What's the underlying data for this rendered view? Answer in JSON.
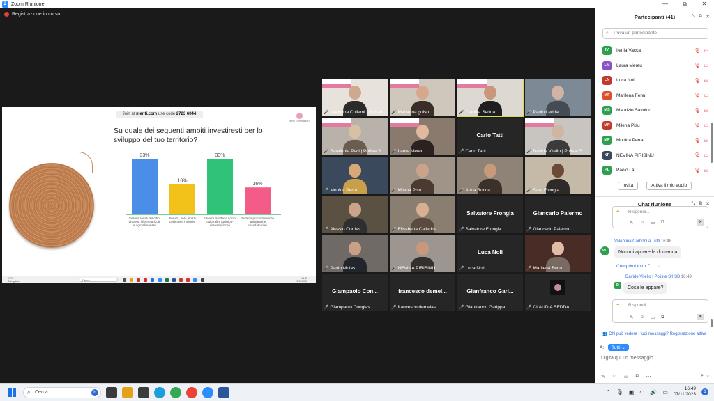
{
  "window": {
    "title": "Zoom Riunione",
    "minimize": "—",
    "maximize": "⧉",
    "close": "✕"
  },
  "recording": {
    "text": "Registrazione in corso"
  },
  "slide": {
    "join_prefix": "Join at",
    "join_site": "menti.com",
    "join_mid": "use code",
    "join_code": "2723 6044",
    "question": "Su quale dei seguenti ambiti investiresti per lo sviluppo del tuo territorio?",
    "logo_text": "Next Generation",
    "inner_taskbar": {
      "weather_temp": "19°C",
      "weather_desc": "Soleggiato",
      "search": "Cerca",
      "time": "16:49",
      "date": "07/11/2023"
    }
  },
  "chart_data": {
    "type": "bar",
    "categories": [
      "Sistemi locali del cibo, distretti, filiere agricole e agroalimentari",
      "Servizi, beni, spazi collettivi e inclusivi",
      "Sistemi di offerta socio-culturali e turistico-ricreativi locali",
      "Sistemi produttivi locali artigianali e manifatturieri"
    ],
    "values": [
      33,
      18,
      33,
      16
    ],
    "value_labels": [
      "33%",
      "18%",
      "33%",
      "16%"
    ],
    "colors": [
      "#4a8ee8",
      "#f2c21b",
      "#2fc37a",
      "#f25c86"
    ],
    "ylim": [
      0,
      40
    ]
  },
  "tiles": [
    {
      "name": "Valentina Chilemi | Poliste ...",
      "video": true,
      "slide": true,
      "bg": "#e8e2dc",
      "head": "#cfa890",
      "torso": "#2b2b2b",
      "active": false
    },
    {
      "name": "Marianna guiso",
      "video": true,
      "slide": true,
      "bg": "#cfc6bc",
      "head": "#d6a98c",
      "torso": "#3a2e28",
      "active": false
    },
    {
      "name": "Claudia Sedda",
      "video": true,
      "slide": true,
      "bg": "#ddd8d2",
      "head": "#c9977c",
      "torso": "#1f1f1f",
      "active": true
    },
    {
      "name": "Paolo Ledda",
      "video": true,
      "slide": false,
      "bg": "#7d8a95",
      "head": "#d2b3a3",
      "torso": "#444b55",
      "active": false
    },
    {
      "name": "Sarafenia Paci | Poliste S...",
      "video": true,
      "slide": true,
      "bg": "#b9b2aa",
      "head": "#d8c0a4",
      "torso": "#6b5c50",
      "active": false
    },
    {
      "name": "Laura Mereu",
      "video": true,
      "slide": true,
      "bg": "#8a7a6e",
      "head": "#e0b9a0",
      "torso": "#2a2220",
      "active": false
    },
    {
      "name": "Carlo Tatti",
      "video": false,
      "display": "Carlo Tatti",
      "active": false
    },
    {
      "name": "Davide Vitello | Poliste S...",
      "video": true,
      "slide": true,
      "bg": "#c8c4bf",
      "head": "#d0b5a2",
      "torso": "#3b3b3b",
      "active": false
    },
    {
      "name": "Monica Perra",
      "video": true,
      "slide": false,
      "bg": "#3a4a5c",
      "head": "#d9a877",
      "torso": "#c9a04a",
      "active": false
    },
    {
      "name": "Milena Pisu",
      "video": true,
      "slide": false,
      "bg": "#a09488",
      "head": "#cba28a",
      "torso": "#4a3a32",
      "active": false
    },
    {
      "name": "Anna Rocca",
      "video": true,
      "slide": false,
      "bg": "#8e8376",
      "head": "#c99a7a",
      "torso": "#3b3129",
      "active": false
    },
    {
      "name": "Sara Frongia",
      "video": true,
      "slide": false,
      "bg": "#c5b9a8",
      "head": "#6b4a36",
      "torso": "#2e2a28",
      "active": false
    },
    {
      "name": "Alessio Corrias",
      "video": true,
      "slide": false,
      "bg": "#5b5142",
      "head": "#c9a48a",
      "torso": "#2f2f2f",
      "active": false
    },
    {
      "name": "Elisabetta Calledda",
      "video": true,
      "slide": false,
      "bg": "#8a7e70",
      "head": "#d8b08f",
      "torso": "#5a4b3f",
      "active": false
    },
    {
      "name": "Salvatore Frongia",
      "video": false,
      "display": "Salvatore Frongia",
      "active": false
    },
    {
      "name": "Giancarlo Palermo",
      "video": false,
      "display": "Giancarlo Palermo",
      "active": false
    },
    {
      "name": "Paolo Mulas",
      "video": true,
      "slide": false,
      "bg": "#6f6a66",
      "head": "#c99f85",
      "torso": "#22252b",
      "active": false
    },
    {
      "name": "NEVINA PIRISINU",
      "video": true,
      "slide": false,
      "bg": "#9d9590",
      "head": "#c9987c",
      "torso": "#34302e",
      "active": false
    },
    {
      "name": "Luca Noli",
      "video": false,
      "display": "Luca Noli",
      "active": false
    },
    {
      "name": "Marilena Fenu",
      "video": true,
      "slide": false,
      "bg": "#4a2c26",
      "head": "#e0bca8",
      "torso": "#7a6a64",
      "active": false
    },
    {
      "name": "Giampaolo Congias",
      "video": false,
      "display": "Giampaolo Con...",
      "active": false
    },
    {
      "name": "francesco demelas",
      "video": false,
      "display": "francesco demel...",
      "active": false
    },
    {
      "name": "Gianfranco Garippa",
      "video": false,
      "display": "Gianfranco Gari...",
      "active": false
    },
    {
      "name": "CLAUDIA SEDDA",
      "video": false,
      "display": "",
      "logo": true,
      "active": false
    }
  ],
  "participants": {
    "title": "Partecipanti (41)",
    "search_placeholder": "Trova un partecipante",
    "list": [
      {
        "initials": "IV",
        "name": "Ilenia Vacca",
        "color": "#2e9e4f"
      },
      {
        "initials": "LM",
        "name": "Laura Mereu",
        "color": "#8a4fc9"
      },
      {
        "initials": "LN",
        "name": "Luca Noli",
        "color": "#c0392b"
      },
      {
        "initials": "MF",
        "name": "Marilena Fenu",
        "color": "#d9502f"
      },
      {
        "initials": "MS",
        "name": "Maurizio Savoldo",
        "color": "#2e9e4f"
      },
      {
        "initials": "MP",
        "name": "Milena Pisu",
        "color": "#c0392b"
      },
      {
        "initials": "MP",
        "name": "Monica Perra",
        "color": "#2e9e4f"
      },
      {
        "initials": "NP",
        "name": "NEVINA PIRISINU",
        "color": "#3a4a5c"
      },
      {
        "initials": "PL",
        "name": "Paolo Lai",
        "color": "#2e9e4f"
      }
    ],
    "invite": "Invita",
    "unmute": "Attiva il mio audio"
  },
  "chat": {
    "title": "Chat riunione",
    "reply_placeholder": "Rispondi...",
    "msg1_sender": "Valentina Carboni a Tutti",
    "msg1_time": "16:48",
    "msg1_text": "Non mi appare la domanda",
    "msg1_avatar": "VC",
    "reply_all": "Comprimi tutto",
    "msg2_sender": "Davide Vitello | Poliste Srl SB",
    "msg2_time": "16:49",
    "msg2_text": "Cosa le appare?",
    "msg2_avatar": "D",
    "who_can_see": "Chi può vedere i tuoi messaggi? Registrazione attiva",
    "to_label": "A:",
    "to_value": "Tutti",
    "input_placeholder": "Digita qui un messaggio..."
  },
  "taskbar": {
    "search": "Cerca",
    "time": "16:49",
    "date": "07/11/2023",
    "notif": "1"
  }
}
